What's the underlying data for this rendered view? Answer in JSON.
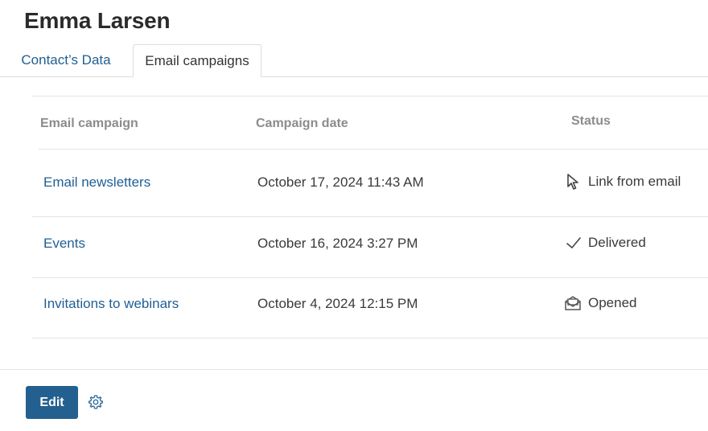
{
  "header": {
    "title": "Emma Larsen"
  },
  "tabs": [
    {
      "label": "Contact’s Data",
      "active": false
    },
    {
      "label": "Email campaigns",
      "active": true
    }
  ],
  "table": {
    "columns": [
      "Email campaign",
      "Campaign date",
      "Status"
    ],
    "rows": [
      {
        "campaign": "Email newsletters",
        "date": "October 17, 2024 11:43 AM",
        "status": "Link from email",
        "status_icon": "cursor-icon"
      },
      {
        "campaign": "Events",
        "date": "October 16, 2024 3:27 PM",
        "status": "Delivered",
        "status_icon": "check-icon"
      },
      {
        "campaign": "Invitations to webinars",
        "date": "October 4, 2024 12:15 PM",
        "status": "Opened",
        "status_icon": "open-envelope-icon"
      }
    ]
  },
  "footer": {
    "edit_label": "Edit",
    "settings_icon": "gear-icon"
  },
  "colors": {
    "accent": "#23608f",
    "link": "#1f5f94"
  }
}
